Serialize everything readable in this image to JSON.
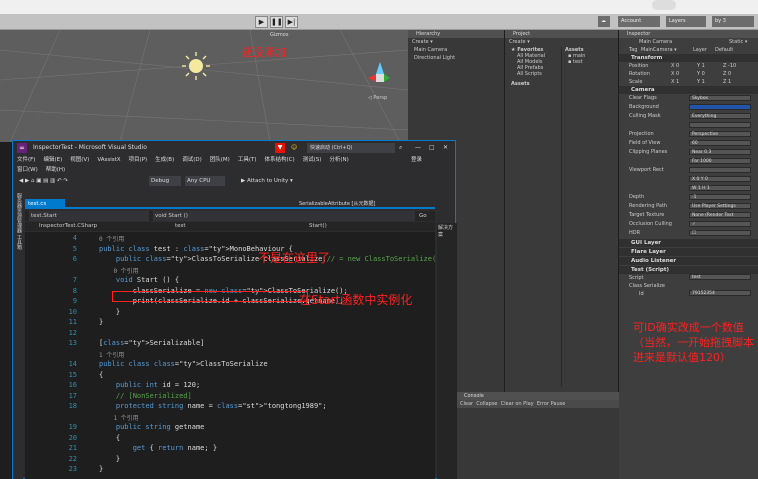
{
  "unity": {
    "toolbar": {
      "account": "Account",
      "layers": "Layers",
      "layout": "by 3"
    },
    "scene": {
      "gizmos": "Gizmos",
      "persp": "◁ Persp",
      "overlay_note": "还没添加"
    },
    "hierarchy": {
      "title": "Hierarchy",
      "create": "Create ▾",
      "items": [
        "Main Camera",
        "Directional Light"
      ]
    },
    "project": {
      "title": "Project",
      "create": "Create ▾",
      "favorites": "Favorites",
      "fav_items": [
        "All Material",
        "All Models",
        "All Prefabs",
        "All Scripts"
      ],
      "assets": "Assets",
      "assets_root": "Assets",
      "asset_items": [
        "main",
        "test"
      ]
    },
    "inspector": {
      "title": "Inspector",
      "object": "Main Camera",
      "static": "Static ▾",
      "tag_label": "Tag",
      "tag": "MainCamera ▾",
      "layer_label": "Layer",
      "layer": "Default",
      "transform": {
        "title": "Transform",
        "rows": [
          [
            "Position",
            "X 0",
            "Y 1",
            "Z -10"
          ],
          [
            "Rotation",
            "X 0",
            "Y 0",
            "Z 0"
          ],
          [
            "Scale",
            "X 1",
            "Y 1",
            "Z 1"
          ]
        ]
      },
      "camera": {
        "title": "Camera",
        "rows": [
          [
            "Clear Flags",
            "Skybox"
          ],
          [
            "Background",
            ""
          ],
          [
            "Culling Mask",
            "Everything"
          ],
          [
            "",
            ""
          ],
          [
            "Projection",
            "Perspective"
          ],
          [
            "Field of View",
            "60"
          ],
          [
            "Clipping Planes",
            "Near  0.3"
          ],
          [
            "",
            "Far   1000"
          ],
          [
            "Viewport Rect",
            ""
          ],
          [
            "",
            "X 0        Y 0"
          ],
          [
            "",
            "W 1        H 1"
          ],
          [
            "Depth",
            "-1"
          ],
          [
            "Rendering Path",
            "Use Player Settings"
          ],
          [
            "Target Texture",
            "None (Render Text"
          ],
          [
            "Occlusion Culling",
            "✓"
          ],
          [
            "HDR",
            "☐"
          ]
        ]
      },
      "components": [
        "GUI Layer",
        "Flare Layer",
        "Audio Listener",
        "Test (Script)"
      ],
      "script": {
        "label": "Script",
        "value": "test"
      },
      "class_serialize": {
        "label": "Class Serialize",
        "id_label": "Id",
        "id_value": "79152354"
      },
      "note": "可ID确实改成一个数值（当然，一开始拖拽脚本进来是默认值120）"
    },
    "console": {
      "title": "Console",
      "buttons": [
        "Clear",
        "Collapse",
        "Clear on Play",
        "Error Pause"
      ]
    }
  },
  "vs": {
    "title": "InspectorTest - Microsoft Visual Studio",
    "quick_launch": "快速启动 (Ctrl+Q)",
    "login": "登录",
    "menu": [
      "文件(F)",
      "编辑(E)",
      "视图(V)",
      "VAssistX",
      "项目(P)",
      "生成(B)",
      "调试(D)",
      "团队(M)",
      "工具(T)",
      "体系结构(C)",
      "测试(S)",
      "分析(N)"
    ],
    "menu2": [
      "窗口(W)",
      "帮助(H)"
    ],
    "toolbar": {
      "config": "Debug",
      "platform": "Any CPU",
      "attach": "▶ Attach to Unity ▾"
    },
    "tab": "test.cs",
    "tab2": "SerializableAttribute [从元数据]",
    "nav": {
      "left": "test.Start",
      "right": "void Start ()",
      "go": "Go"
    },
    "nav2": {
      "left": "InspectorTest.CSharp",
      "mid": "test",
      "right": "Start()"
    },
    "side_left": "服务器资源管理器  工具箱",
    "right_tab": "解决方案",
    "lines": [
      {
        "n": "4",
        "ref": "0 个引用"
      },
      {
        "n": "5",
        "code": "public class test : MonoBehaviour {"
      },
      {
        "n": "6",
        "code": "    public ClassToSerialize classSerialize;// = new ClassToSerialize()"
      },
      {
        "n": "",
        "ref": "    0 个引用"
      },
      {
        "n": "7",
        "code": "    void Start () {"
      },
      {
        "n": "8",
        "code": "        classSerialize = new ClassToSerialize();"
      },
      {
        "n": "9",
        "code": "        print(classSerialize.id + classSerialize.getname);"
      },
      {
        "n": "10",
        "code": "    }"
      },
      {
        "n": "11",
        "code": "}"
      },
      {
        "n": "12",
        "code": ""
      },
      {
        "n": "13",
        "code": "[Serializable]"
      },
      {
        "n": "",
        "ref": "1 个引用"
      },
      {
        "n": "14",
        "code": "public class ClassToSerialize"
      },
      {
        "n": "15",
        "code": "{"
      },
      {
        "n": "16",
        "code": "    public int id = 120;"
      },
      {
        "n": "17",
        "code": "    // [NonSerialized]"
      },
      {
        "n": "18",
        "code": "    protected string name = \"tongtong1989\";"
      },
      {
        "n": "",
        "ref": "    1 个引用"
      },
      {
        "n": "19",
        "code": "    public string getname"
      },
      {
        "n": "20",
        "code": "    {"
      },
      {
        "n": "21",
        "code": "        get { return name; }"
      },
      {
        "n": "22",
        "code": "    }"
      },
      {
        "n": "23",
        "code": "}"
      }
    ],
    "note1": "不是在这里了",
    "note2": "在Start函数中实例化"
  }
}
